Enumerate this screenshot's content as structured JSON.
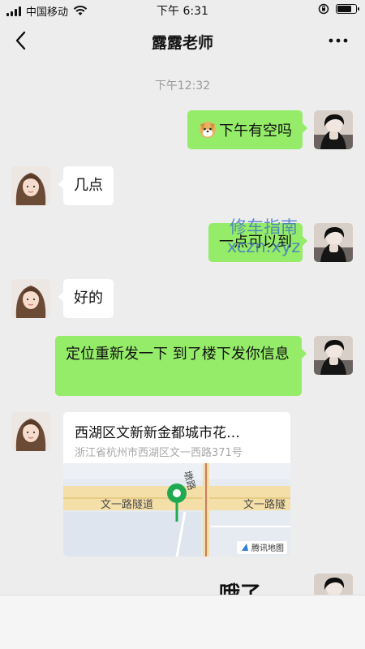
{
  "status_bar": {
    "carrier": "中国移动",
    "time": "下午 6:31",
    "icons": [
      "signal-bars-icon",
      "wifi-icon",
      "orientation-lock-icon",
      "battery-icon"
    ]
  },
  "chat": {
    "title": "露露老师",
    "timestamp": "下午12:32"
  },
  "messages": [
    {
      "side": "out",
      "text": "下午有空吗",
      "emoji": "dog-face-emoji"
    },
    {
      "side": "in",
      "text": "几点"
    },
    {
      "side": "out",
      "text": "一点可以到"
    },
    {
      "side": "in",
      "text": "好的"
    },
    {
      "side": "out",
      "text": "定位重新发一下 到了楼下发你信息"
    },
    {
      "side": "in",
      "type": "location"
    },
    {
      "side": "out",
      "text": "哦了"
    }
  ],
  "location": {
    "title": "西湖区文新新金都城市花…",
    "address": "浙江省杭州市西湖区文一西路371号",
    "road_labels": [
      "文一路隧道",
      "文一路隧",
      "墩路"
    ],
    "provider": "腾讯地图"
  },
  "watermark": {
    "line1": "修车指南",
    "line2": "xczn.xyz"
  },
  "colors": {
    "background": "#ededed",
    "outgoing_bubble": "#95ec69",
    "incoming_bubble": "#ffffff",
    "timestamp": "#9a9a9a",
    "map_pin": "#1faa52"
  }
}
